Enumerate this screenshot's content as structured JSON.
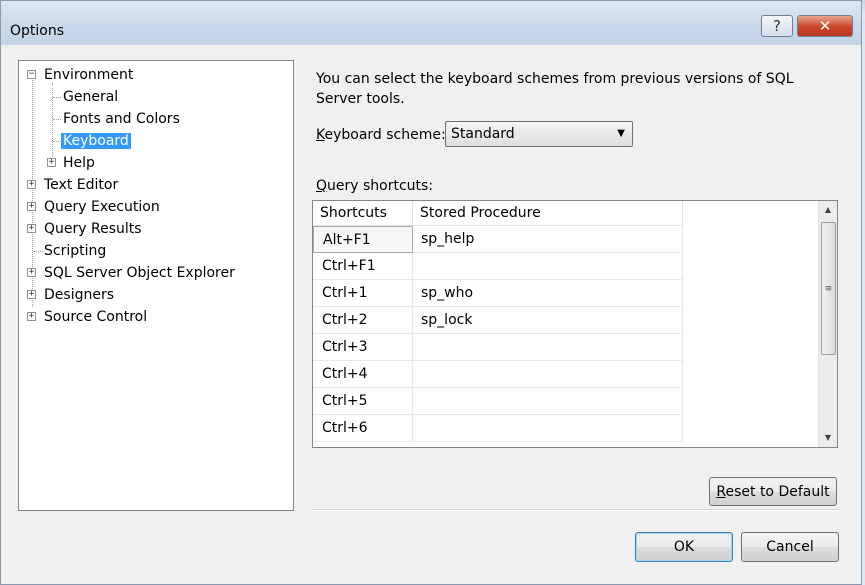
{
  "window": {
    "title": "Options",
    "help_label": "?",
    "close_label": "✕"
  },
  "tree": {
    "items": [
      {
        "label": "Environment",
        "expander": "−"
      },
      {
        "label": "General"
      },
      {
        "label": "Fonts and Colors"
      },
      {
        "label": "Keyboard",
        "selected": true
      },
      {
        "label": "Help",
        "expander": "+"
      },
      {
        "label": "Text Editor",
        "expander": "+"
      },
      {
        "label": "Query Execution",
        "expander": "+"
      },
      {
        "label": "Query Results",
        "expander": "+"
      },
      {
        "label": "Scripting"
      },
      {
        "label": "SQL Server Object Explorer",
        "expander": "+"
      },
      {
        "label": "Designers",
        "expander": "+"
      },
      {
        "label": "Source Control",
        "expander": "+"
      }
    ]
  },
  "panel": {
    "description": "You can select the keyboard schemes from previous versions of SQL Server tools.",
    "keyboard_scheme_label_key": "K",
    "keyboard_scheme_label_rest": "eyboard scheme:",
    "keyboard_scheme_value": "Standard",
    "query_shortcuts_label_key": "Q",
    "query_shortcuts_label_rest": "uery shortcuts:"
  },
  "grid": {
    "columns": [
      "Shortcuts",
      "Stored Procedure"
    ],
    "rows": [
      [
        "Alt+F1",
        "sp_help"
      ],
      [
        "Ctrl+F1",
        ""
      ],
      [
        "Ctrl+1",
        "sp_who"
      ],
      [
        "Ctrl+2",
        "sp_lock"
      ],
      [
        "Ctrl+3",
        ""
      ],
      [
        "Ctrl+4",
        ""
      ],
      [
        "Ctrl+5",
        ""
      ],
      [
        "Ctrl+6",
        ""
      ]
    ]
  },
  "buttons": {
    "reset_key": "R",
    "reset_rest": "eset to Default",
    "ok": "OK",
    "cancel": "Cancel"
  },
  "colors": {
    "selection": "#3399ff",
    "dialog_bg": "#f0f0f0"
  }
}
